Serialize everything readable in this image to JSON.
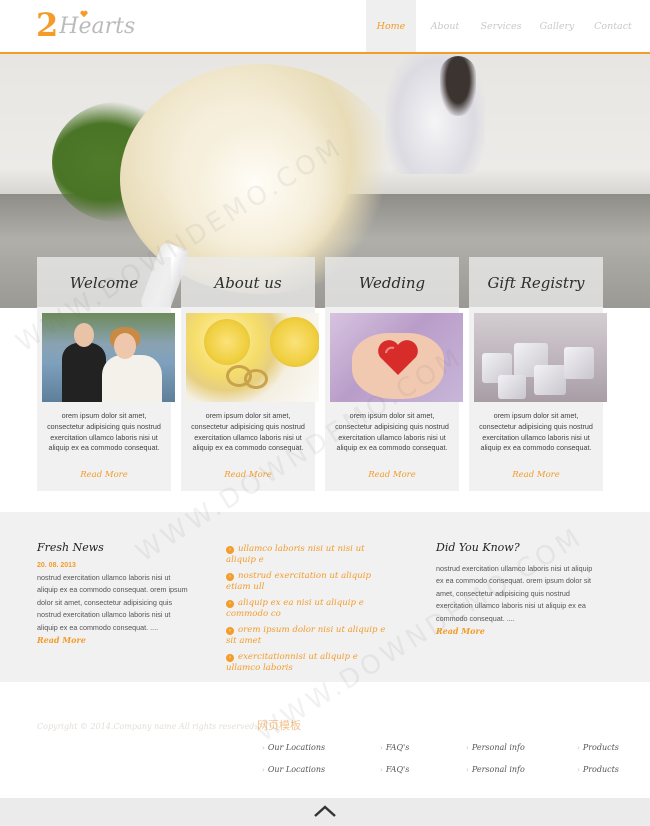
{
  "header": {
    "logo": {
      "digit": "2",
      "word": "Hearts"
    },
    "nav": [
      "Home",
      "About",
      "Services",
      "Gallery",
      "Contact"
    ],
    "active_nav": "Home"
  },
  "tabs": [
    "Welcome",
    "About us",
    "Wedding",
    "Gift Registry"
  ],
  "cards": [
    {
      "text": "orem ipsum dolor sit amet, consectetur adipisicing quis nostrud exercitation ullamco laboris nisi ut aliquip ex ea commodo consequat.",
      "more": "Read More"
    },
    {
      "text": "orem ipsum dolor sit amet, consectetur adipisicing quis nostrud exercitation ullamco laboris nisi ut aliquip ex ea commodo consequat.",
      "more": "Read More"
    },
    {
      "text": "orem ipsum dolor sit amet, consectetur adipisicing quis nostrud exercitation ullamco laboris nisi ut aliquip ex ea commodo consequat.",
      "more": "Read More"
    },
    {
      "text": "orem ipsum dolor sit amet, consectetur adipisicing quis nostrud exercitation ullamco laboris nisi ut aliquip ex ea commodo consequat.",
      "more": "Read More"
    }
  ],
  "fresh_news": {
    "title": "Fresh News",
    "date": "20. 08. 2013",
    "text": "nostrud exercitation ullamco laboris nisi ut aliquip ex ea commodo consequat. orem ipsum dolor sit amet, consectetur adipisicing quis nostrud exercitation ullamco laboris nisi ut aliquip ex ea commodo consequat. ....",
    "more": "Read More"
  },
  "links": [
    "ullamco laboris nisi ut nisi ut aliquip e",
    "nostrud exercitation ut aliquip etiam ull",
    "aliquip ex ea nisi ut aliquip e commodo co",
    "orem ipsum dolor nisi ut aliquip e sit amet",
    "exercitationnisi ut aliquip e ullamco laboris"
  ],
  "did_you_know": {
    "title": "Did You Know?",
    "text": "nostrud exercitation ullamco laboris nisi ut aliquip ex ea commodo consequat. orem ipsum dolor sit amet, consectetur adipisicing quis nostrud exercitation ullamco laboris nisi ut aliquip ex ea commodo consequat. ....",
    "more": "Read More"
  },
  "footer": {
    "copyright": "Copyright © 2014.Company name All rights reserved.",
    "copyright_cn": "网页模板",
    "links_row1": [
      "Our Locations",
      "FAQ's",
      "Personal info",
      "Products"
    ],
    "links_row2": [
      "Our Locations",
      "FAQ's",
      "Personal info",
      "Products"
    ]
  },
  "watermark": "WWW.DOWNDEMO.COM",
  "colors": {
    "accent": "#f39c2a",
    "panel": "#f1f1f1",
    "text": "#555555"
  }
}
